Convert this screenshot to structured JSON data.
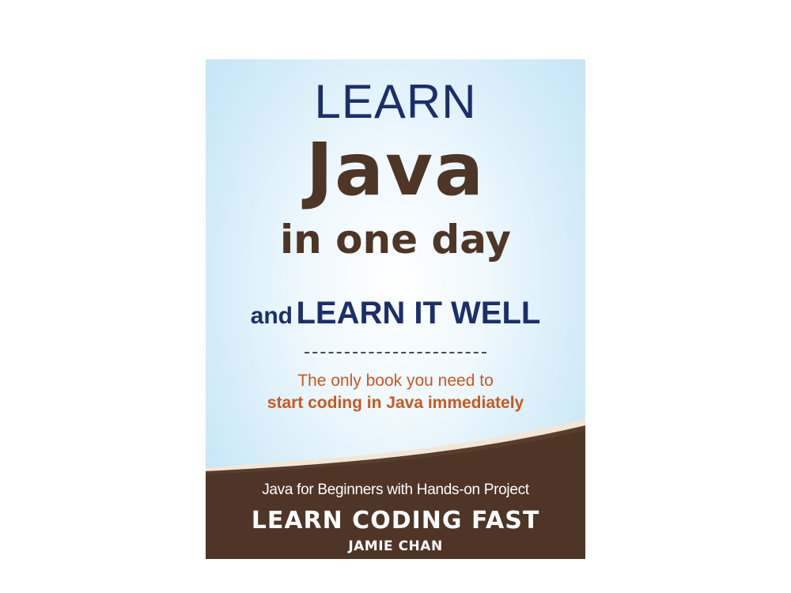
{
  "cover": {
    "title_line1": "LEARN",
    "title_line2": "Java",
    "title_line3": "in one day",
    "title_and": "and",
    "title_well": "LEARN IT WELL",
    "tagline_line1": "The only book you need to",
    "tagline_line2": "start coding in Java immediately",
    "subtitle": "Java for Beginners with Hands-on Project",
    "series": "LEARN CODING FAST",
    "author": "JAMIE CHAN"
  },
  "colors": {
    "navy": "#1a2f6b",
    "brown": "#4e3526",
    "orange": "#c8581f",
    "sky": "#cfeaf8"
  }
}
